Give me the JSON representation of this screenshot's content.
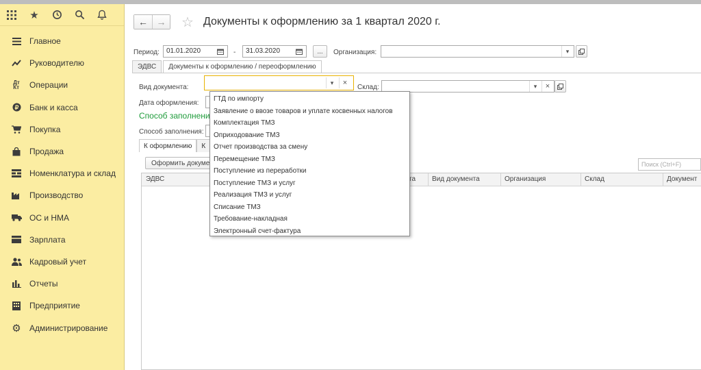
{
  "sidebar": {
    "top_icons": [
      "apps-grid-icon",
      "star-icon",
      "history-icon",
      "search-icon",
      "bell-icon"
    ],
    "items": [
      {
        "label": "Главное",
        "icon": "menu-lines-icon"
      },
      {
        "label": "Руководителю",
        "icon": "trend-chart-icon"
      },
      {
        "label": "Операции",
        "icon": "debit-credit-icon"
      },
      {
        "label": "Банк и касса",
        "icon": "coin-icon"
      },
      {
        "label": "Покупка",
        "icon": "cart-icon"
      },
      {
        "label": "Продажа",
        "icon": "shopping-bag-icon"
      },
      {
        "label": "Номенклатура и склад",
        "icon": "warehouse-icon"
      },
      {
        "label": "Производство",
        "icon": "factory-icon"
      },
      {
        "label": "ОС и НМА",
        "icon": "truck-icon"
      },
      {
        "label": "Зарплата",
        "icon": "wallet-icon"
      },
      {
        "label": "Кадровый учет",
        "icon": "people-icon"
      },
      {
        "label": "Отчеты",
        "icon": "bar-chart-icon"
      },
      {
        "label": "Предприятие",
        "icon": "building-icon"
      },
      {
        "label": "Администрирование",
        "icon": "gear-icon"
      }
    ]
  },
  "header": {
    "title": "Документы к оформлению  за 1 квартал 2020 г."
  },
  "filters": {
    "period_label": "Период:",
    "date_from": "01.01.2020",
    "date_to": "31.03.2020",
    "dash": "-",
    "dots": "...",
    "org_label": "Организация:",
    "org_value": ""
  },
  "tabs": [
    {
      "label": "ЭДВС",
      "active": false
    },
    {
      "label": "Документы к оформлению / переоформлению",
      "active": true
    }
  ],
  "form": {
    "doc_type_label": "Вид документа:",
    "doc_type_value": "",
    "warehouse_label": "Склад:",
    "warehouse_value": "",
    "date_label": "Дата оформления:",
    "fill_group_title": "Способ заполнени",
    "fill_label": "Способ заполнения:"
  },
  "inner_tabs": [
    {
      "label": "К оформлению"
    },
    {
      "label": "К"
    }
  ],
  "toolbar": {
    "process_button": "Оформить докуме",
    "search_placeholder": "Поиск (Ctrl+F)"
  },
  "grid": {
    "columns": [
      "ЭДВС",
      "та",
      "Вид документа",
      "Организация",
      "Склад",
      "Документ"
    ]
  },
  "dropdown": {
    "options": [
      "ГТД по импорту",
      "Заявление о ввозе товаров и уплате косвенных налогов",
      "Комплектация ТМЗ",
      "Оприходование ТМЗ",
      "Отчет производства за смену",
      "Перемещение ТМЗ",
      "Поступление из переработки",
      "Поступление ТМЗ и услуг",
      "Реализация ТМЗ и услуг",
      "Списание ТМЗ",
      "Требование-накладная",
      "Электронный счет-фактура"
    ]
  },
  "colors": {
    "sidebar_bg": "#fbeda2",
    "accent_green": "#1e9b3a",
    "focus_border": "#e8b200"
  }
}
